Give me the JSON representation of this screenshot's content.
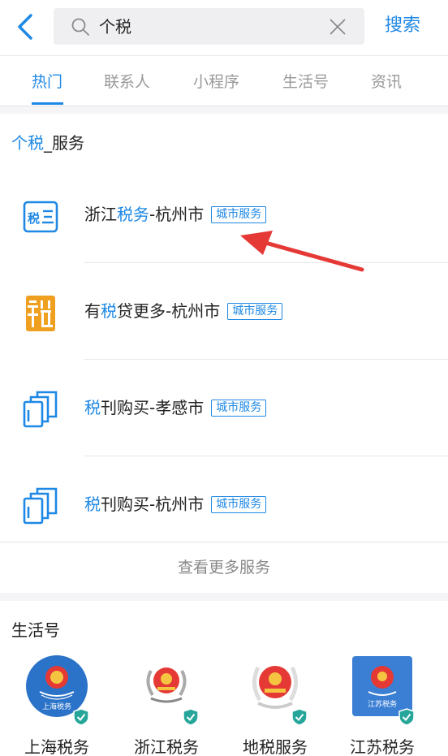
{
  "search": {
    "query": "个税",
    "button": "搜索"
  },
  "tabs": [
    {
      "label": "热门",
      "active": true
    },
    {
      "label": "联系人",
      "active": false
    },
    {
      "label": "小程序",
      "active": false
    },
    {
      "label": "生活号",
      "active": false
    },
    {
      "label": "资讯",
      "active": false
    }
  ],
  "services": {
    "title_highlight": "个税",
    "title_rest": "_服务",
    "items": [
      {
        "pre": "浙江",
        "hl": "税务",
        "post": "-杭州市",
        "badge": "城市服务",
        "icon": "tax-bureau-icon"
      },
      {
        "pre": "有",
        "hl": "税",
        "post": "贷更多-杭州市",
        "badge": "城市服务",
        "icon": "tax-loan-icon"
      },
      {
        "pre": "",
        "hl": "税",
        "post": "刊购买-孝感市",
        "badge": "城市服务",
        "icon": "magazine-icon"
      },
      {
        "pre": "",
        "hl": "税",
        "post": "刊购买-杭州市",
        "badge": "城市服务",
        "icon": "magazine-icon"
      }
    ],
    "more": "查看更多服务"
  },
  "life": {
    "title": "生活号",
    "accounts": [
      {
        "name": "上海税务",
        "logo_text": "上海税务",
        "verified": true
      },
      {
        "name": "浙江税务",
        "logo_text": "",
        "verified": true
      },
      {
        "name": "地税服务",
        "logo_text": "",
        "verified": true
      },
      {
        "name": "江苏税务",
        "logo_text": "江苏税务",
        "verified": true
      }
    ]
  },
  "colors": {
    "accent": "#1e88e5",
    "annotation_arrow": "#e53935",
    "verified": "#26a69a"
  }
}
